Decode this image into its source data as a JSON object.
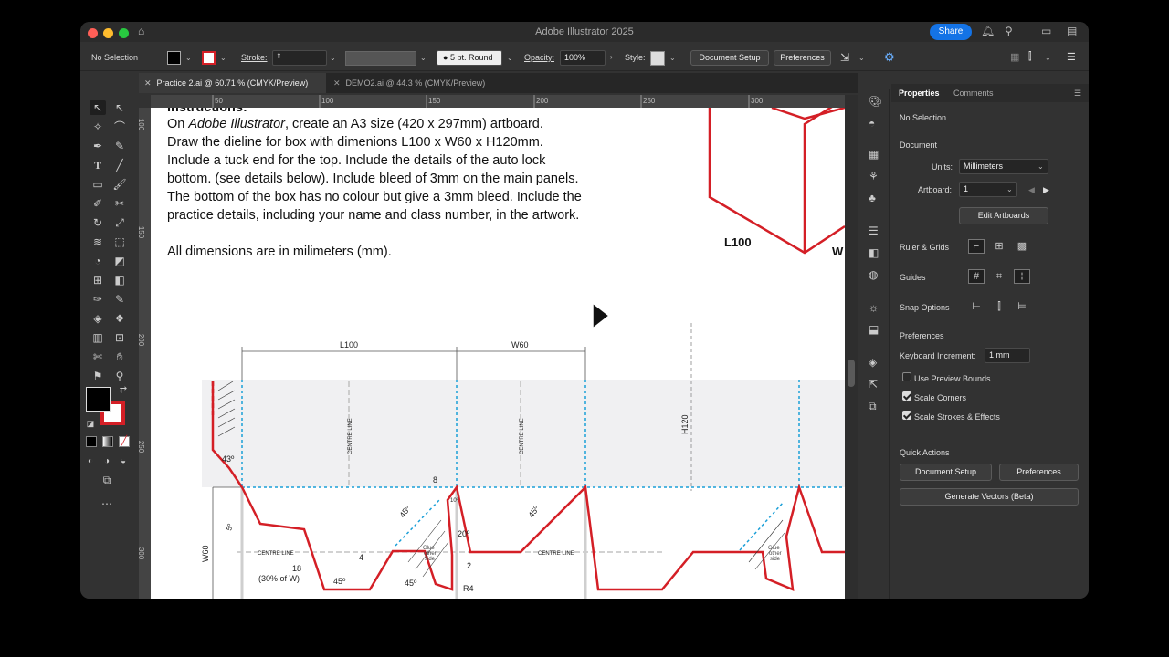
{
  "app": {
    "title": "Adobe Illustrator 2025",
    "share_label": "Share"
  },
  "control_bar": {
    "selection": "No Selection",
    "stroke_label": "Stroke:",
    "brush": "5 pt. Round",
    "opacity_label": "Opacity:",
    "opacity_value": "100%",
    "style_label": "Style:",
    "document_setup": "Document Setup",
    "preferences": "Preferences"
  },
  "tabs": [
    {
      "label": "Practice 2.ai @ 60.71 % (CMYK/Preview)",
      "active": true
    },
    {
      "label": "DEMO2.ai @ 44.3 % (CMYK/Preview)",
      "active": false
    }
  ],
  "rulers": {
    "horizontal": [
      "50",
      "100",
      "150",
      "200",
      "250",
      "300"
    ],
    "vertical": [
      "100",
      "150",
      "200",
      "250",
      "300"
    ]
  },
  "document": {
    "heading": "Instructions:",
    "lines": [
      {
        "pre": "On ",
        "em": "Adobe Illustrator",
        "post": ", create an A3 size (420 x 297mm) artboard."
      },
      {
        "pre": "Draw the dieline for box with dimenions L100 x W60 x H120mm.",
        "em": "",
        "post": ""
      },
      {
        "pre": "Include a tuck end for the top. Include the details of the auto lock",
        "em": "",
        "post": ""
      },
      {
        "pre": "bottom. (see details below). Include bleed of 3mm on the main panels.",
        "em": "",
        "post": ""
      },
      {
        "pre": "The bottom of the box has no colour but give a 3mm bleed. Include the",
        "em": "",
        "post": ""
      },
      {
        "pre": "practice details, including your name and class number, in the artwork.",
        "em": "",
        "post": ""
      }
    ],
    "note": "All dimensions are in milimeters (mm).",
    "box_labels": {
      "l": "L100",
      "w": "W"
    },
    "dieline": {
      "dim_l": "L100",
      "dim_w": "W60",
      "dim_h": "H120",
      "dim_w60": "W60",
      "centre1": "CENTRE LINE",
      "centre2": "CENTRE LINE",
      "centre3": "CENTRE LINE",
      "centre4": "CENTRE LINE",
      "a43": "43º",
      "a45a": "45º",
      "a45b": "45º",
      "a45c": "45º",
      "a45d": "45º",
      "a5": "5º",
      "a20": "20º",
      "a10": "10º",
      "n8": "8",
      "n18": "18",
      "n30": "(30% of W)",
      "n4": "4",
      "n2": "2",
      "r4": "R4",
      "glue1": [
        "Glue",
        "other",
        "side"
      ],
      "glue2": [
        "Glue",
        "other",
        "side"
      ]
    }
  },
  "properties": {
    "tab_properties": "Properties",
    "tab_comments": "Comments",
    "no_selection": "No Selection",
    "document_header": "Document",
    "units_label": "Units:",
    "units_value": "Millimeters",
    "artboard_label": "Artboard:",
    "artboard_value": "1",
    "edit_artboards": "Edit Artboards",
    "rulers_grids": "Ruler & Grids",
    "guides": "Guides",
    "snap_options": "Snap Options",
    "preferences_header": "Preferences",
    "keyboard_increment_label": "Keyboard Increment:",
    "keyboard_increment_value": "1 mm",
    "use_preview_bounds": "Use Preview Bounds",
    "scale_corners": "Scale Corners",
    "scale_strokes": "Scale Strokes & Effects",
    "quick_actions": "Quick Actions",
    "qa_document_setup": "Document Setup",
    "qa_preferences": "Preferences",
    "generate_vectors": "Generate Vectors (Beta)"
  },
  "colors": {
    "accent": "#1473e6",
    "dieline": "#d41f26",
    "guide": "#1a9fd8",
    "panel": "#323232"
  }
}
